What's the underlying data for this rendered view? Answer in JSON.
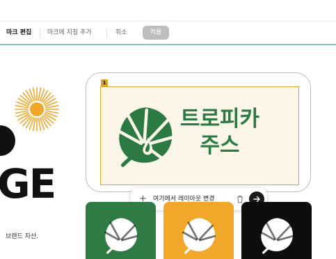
{
  "toolbar": {
    "title": "마크 편집",
    "add_guide": "마크에 지침 추가",
    "cancel": "취소",
    "apply": "적용"
  },
  "left_panel": {
    "big_text": "GE",
    "brand_assets": "브랜드 자산."
  },
  "canvas": {
    "layer_number": "1",
    "logo_line1": "트로피카",
    "logo_line2": "주스",
    "logo_icon": "monstera-leaf-icon"
  },
  "prompt": {
    "text": "여기에서 레이아웃 변경",
    "icons": [
      "plus-icon",
      "trash-icon",
      "arrow-right-icon"
    ]
  },
  "variants": [
    {
      "background": "#2f7a45",
      "icon": "monstera-leaf-icon"
    },
    {
      "background": "#f0a72a",
      "icon": "monstera-leaf-icon"
    },
    {
      "background": "#0d0d0d",
      "icon": "monstera-leaf-icon"
    }
  ],
  "colors": {
    "accent_teal": "#7fc7c0",
    "logo_green": "#2c7a43",
    "frame_gold": "#d9a628",
    "sun_yellow": "#f0a72a"
  }
}
